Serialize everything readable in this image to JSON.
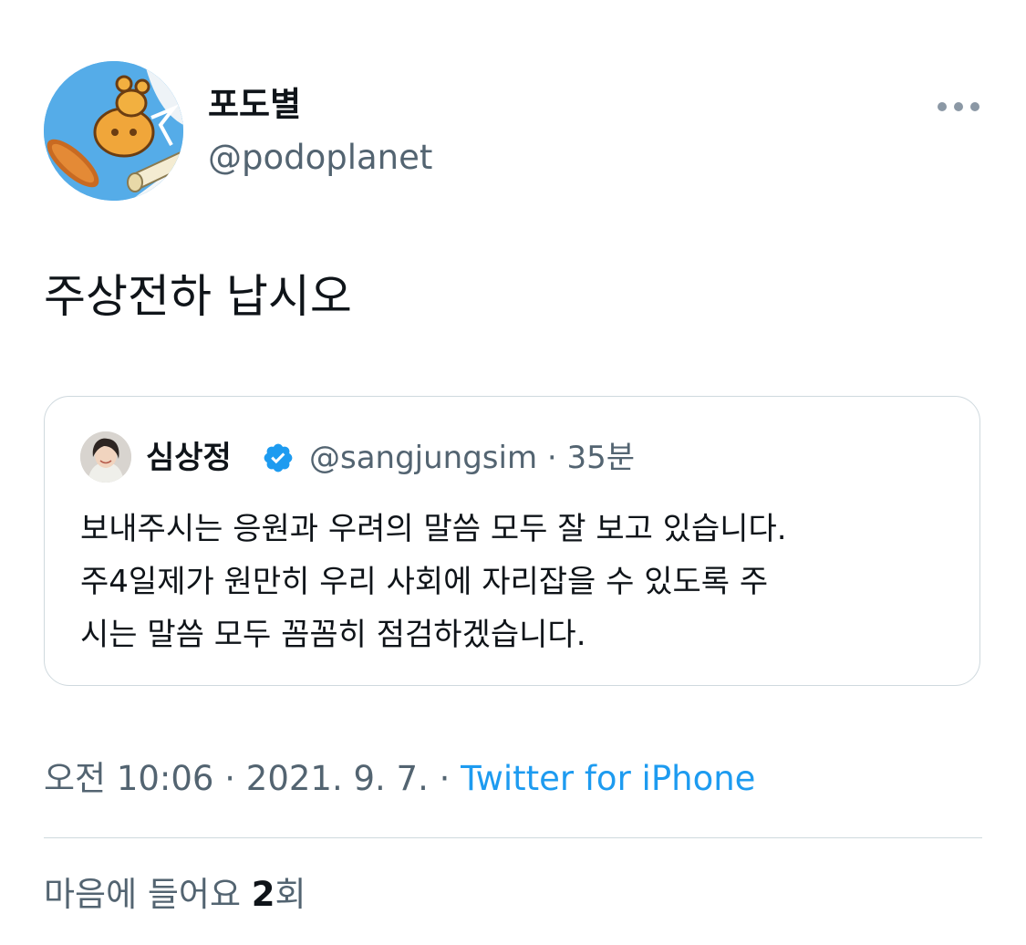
{
  "author": {
    "display_name": "포도별",
    "handle": "@podoplanet"
  },
  "tweet": {
    "text": "주상전하 납시오"
  },
  "quoted_tweet": {
    "display_name": "심상정",
    "handle": "@sangjungsim",
    "separator": "·",
    "time_ago": "35분",
    "verified": true,
    "lines": [
      "보내주시는 응원과 우려의 말씀 모두 잘 보고 있습니다.",
      "주4일제가 원만히 우리 사회에 자리잡을 수 있도록 주",
      "시는 말씀 모두 꼼꼼히 점검하겠습니다."
    ]
  },
  "meta": {
    "time": "오전 10:06",
    "separator": "·",
    "date": "2021. 9. 7.",
    "source": "Twitter for iPhone"
  },
  "likes": {
    "label": "마음에 들어요",
    "count": "2",
    "suffix": "회"
  },
  "icons": {
    "more": "more-horizontal-icon",
    "verified": "verified-badge-icon"
  },
  "colors": {
    "text_primary": "#0f1419",
    "text_secondary": "#536471",
    "link": "#1d9bf0",
    "verified": "#1d9bf0",
    "border": "#cfd9de"
  }
}
